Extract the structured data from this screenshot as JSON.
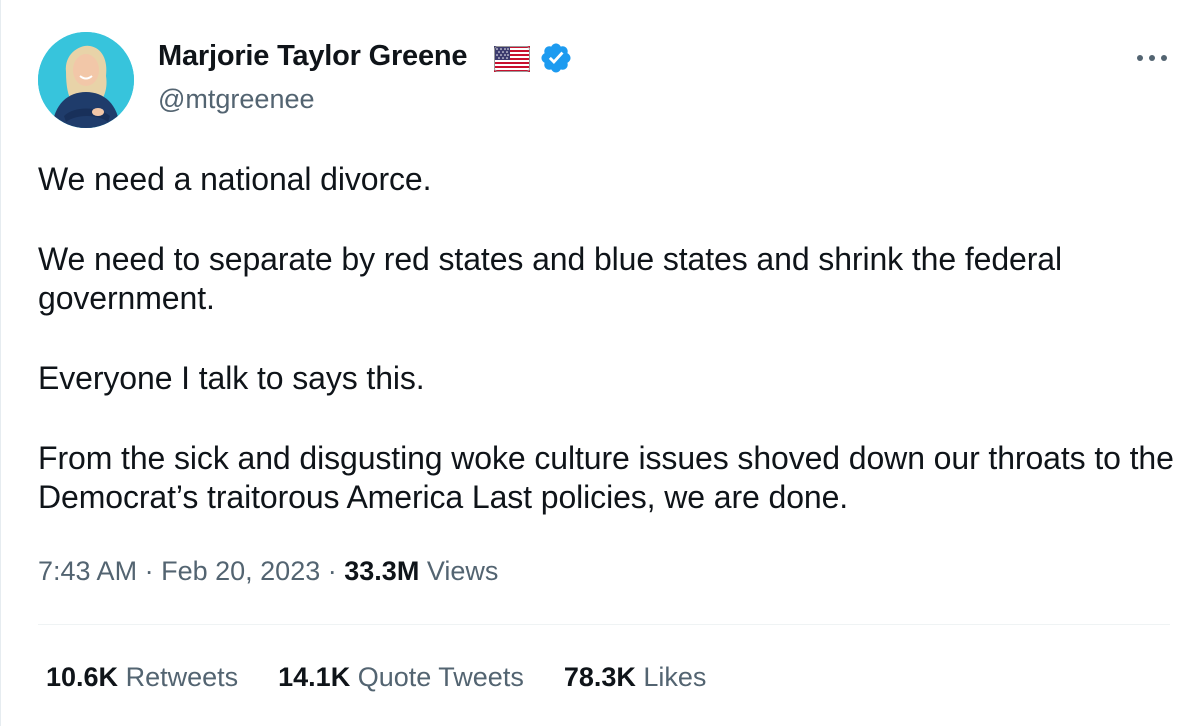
{
  "author": {
    "display_name": "Marjorie Taylor Greene",
    "handle": "@mtgreenee",
    "flag_emoji_icon": "us-flag-icon",
    "verified_icon": "verified-badge-icon",
    "verified_color": "#1d9bf0"
  },
  "menu": {
    "more_icon": "more-horizontal-icon"
  },
  "tweet": {
    "paragraphs": [
      "We need a national divorce.",
      "We need to separate by red states and blue states and shrink the federal government.",
      "Everyone I talk to says this.",
      "From the sick and disgusting woke culture issues shoved down our throats to the Democrat’s traitorous America Last policies, we are done."
    ]
  },
  "meta": {
    "time": "7:43 AM",
    "separator": "·",
    "date": "Feb 20, 2023",
    "views_count": "33.3M",
    "views_label": "Views"
  },
  "stats": {
    "retweets_count": "10.6K",
    "retweets_label": "Retweets",
    "quotes_count": "14.1K",
    "quotes_label": "Quote Tweets",
    "likes_count": "78.3K",
    "likes_label": "Likes"
  },
  "colors": {
    "text_primary": "#0f1419",
    "text_secondary": "#536471",
    "divider": "#eff3f4",
    "avatar_background": "#37c4dc"
  }
}
